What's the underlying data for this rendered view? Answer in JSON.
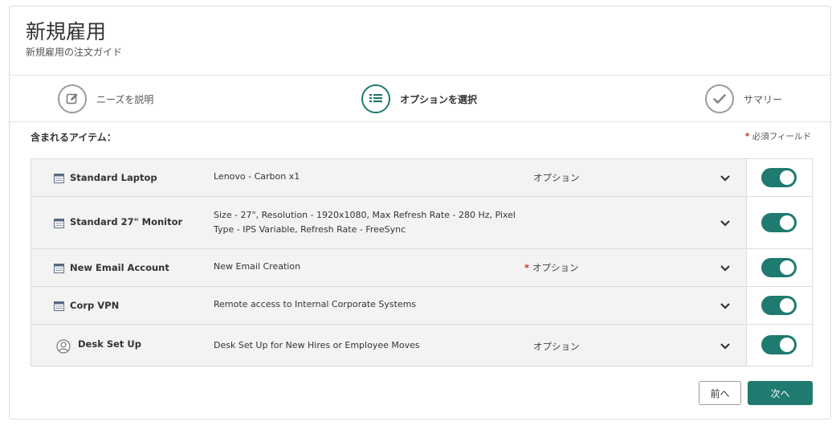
{
  "header": {
    "title": "新規雇用",
    "subtitle": "新規雇用の注文ガイド"
  },
  "steps": [
    {
      "label": "ニーズを説明",
      "icon": "edit-icon",
      "active": false
    },
    {
      "label": "オプションを選択",
      "icon": "list-icon",
      "active": true
    },
    {
      "label": "サマリー",
      "icon": "checkmark-icon",
      "active": false
    }
  ],
  "section": {
    "title": "含まれるアイテム：",
    "required_star": "*",
    "required_text": "必須フィールド"
  },
  "items": [
    {
      "name": "Standard Laptop",
      "description": "Lenovo - Carbon x1",
      "option": "オプション",
      "required": false,
      "icon": "catalog-icon",
      "enabled": true
    },
    {
      "name": "Standard 27\" Monitor",
      "description": "Size - 27\", Resolution - 1920x1080, Max Refresh Rate - 280 Hz, Pixel Type - IPS Variable, Refresh Rate - FreeSync",
      "option": "",
      "required": false,
      "icon": "catalog-icon",
      "enabled": true
    },
    {
      "name": "New Email Account",
      "description": "New Email Creation",
      "option": "オプション",
      "required": true,
      "icon": "catalog-icon",
      "enabled": true
    },
    {
      "name": "Corp VPN",
      "description": "Remote access to Internal Corporate Systems",
      "option": "",
      "required": false,
      "icon": "catalog-icon",
      "enabled": true
    },
    {
      "name": "Desk Set Up",
      "description": "Desk Set Up for New Hires or Employee Moves",
      "option": "オプション",
      "required": false,
      "icon": "user-icon",
      "enabled": true
    }
  ],
  "buttons": {
    "prev_label": "前へ",
    "next_label": "次へ"
  },
  "colors": {
    "accent": "#1f7a6f",
    "required": "#c0312b",
    "row_background": "#f3f3f3"
  }
}
